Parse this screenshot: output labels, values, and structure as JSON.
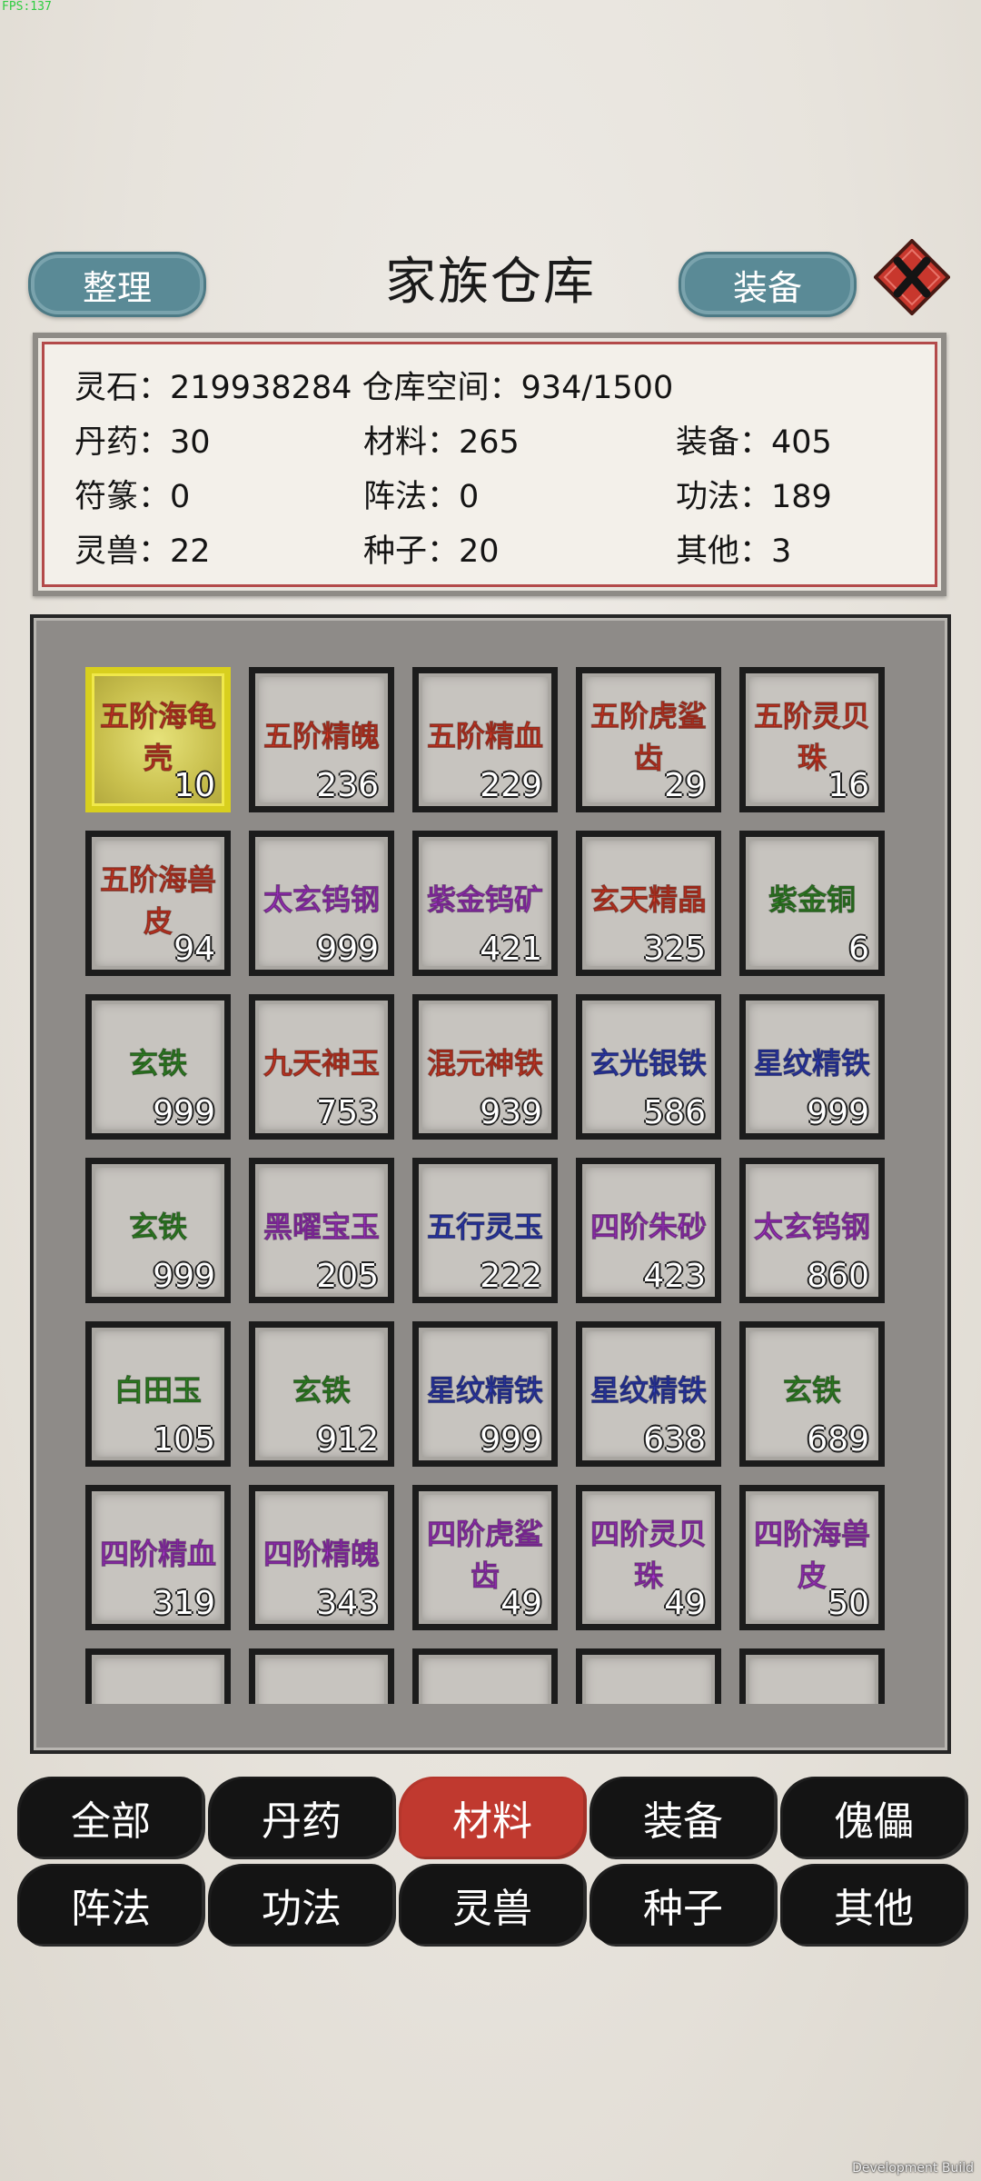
{
  "debug": {
    "fps": "FPS:137",
    "build": "Development Build"
  },
  "header": {
    "left_button": "整理",
    "title": "家族仓库",
    "right_button": "装备",
    "close_icon": "close-icon"
  },
  "stats": {
    "line1": "灵石：219938284 仓库空间：934/1500",
    "cells": [
      [
        "丹药：30",
        "材料：265",
        "装备：405"
      ],
      [
        "符篆：0",
        "阵法：0",
        "功法：189"
      ],
      [
        "灵兽：22",
        "种子：20",
        "其他：3"
      ]
    ]
  },
  "colors": {
    "red": "#e8402a",
    "purple": "#b23ad8",
    "blue": "#3443c8",
    "green": "#3a9a2c",
    "active_tab": "#c0392f"
  },
  "items": [
    {
      "name": "五阶海龟壳",
      "count": "10",
      "quality": "red",
      "selected": true
    },
    {
      "name": "五阶精魄",
      "count": "236",
      "quality": "red"
    },
    {
      "name": "五阶精血",
      "count": "229",
      "quality": "red"
    },
    {
      "name": "五阶虎鲨齿",
      "count": "29",
      "quality": "red"
    },
    {
      "name": "五阶灵贝珠",
      "count": "16",
      "quality": "red"
    },
    {
      "name": "五阶海兽皮",
      "count": "94",
      "quality": "red"
    },
    {
      "name": "太玄钨钢",
      "count": "999",
      "quality": "purple"
    },
    {
      "name": "紫金钨矿",
      "count": "421",
      "quality": "purple"
    },
    {
      "name": "玄天精晶",
      "count": "325",
      "quality": "red"
    },
    {
      "name": "紫金铜",
      "count": "6",
      "quality": "green"
    },
    {
      "name": "玄铁",
      "count": "999",
      "quality": "green"
    },
    {
      "name": "九天神玉",
      "count": "753",
      "quality": "red"
    },
    {
      "name": "混元神铁",
      "count": "939",
      "quality": "red"
    },
    {
      "name": "玄光银铁",
      "count": "586",
      "quality": "blue"
    },
    {
      "name": "星纹精铁",
      "count": "999",
      "quality": "blue"
    },
    {
      "name": "玄铁",
      "count": "999",
      "quality": "green"
    },
    {
      "name": "黑曜宝玉",
      "count": "205",
      "quality": "purple"
    },
    {
      "name": "五行灵玉",
      "count": "222",
      "quality": "blue"
    },
    {
      "name": "四阶朱砂",
      "count": "423",
      "quality": "purple"
    },
    {
      "name": "太玄钨钢",
      "count": "860",
      "quality": "purple"
    },
    {
      "name": "白田玉",
      "count": "105",
      "quality": "green"
    },
    {
      "name": "玄铁",
      "count": "912",
      "quality": "green"
    },
    {
      "name": "星纹精铁",
      "count": "999",
      "quality": "blue"
    },
    {
      "name": "星纹精铁",
      "count": "638",
      "quality": "blue"
    },
    {
      "name": "玄铁",
      "count": "689",
      "quality": "green"
    },
    {
      "name": "四阶精血",
      "count": "319",
      "quality": "purple"
    },
    {
      "name": "四阶精魄",
      "count": "343",
      "quality": "purple"
    },
    {
      "name": "四阶虎鲨齿",
      "count": "49",
      "quality": "purple"
    },
    {
      "name": "四阶灵贝珠",
      "count": "49",
      "quality": "purple"
    },
    {
      "name": "四阶海兽皮",
      "count": "50",
      "quality": "purple"
    },
    {
      "name": "",
      "count": "",
      "quality": "green"
    },
    {
      "name": "",
      "count": "",
      "quality": "green"
    },
    {
      "name": "",
      "count": "",
      "quality": "green"
    },
    {
      "name": "",
      "count": "",
      "quality": "green"
    },
    {
      "name": "",
      "count": "",
      "quality": "green"
    }
  ],
  "tabs": [
    {
      "label": "全部",
      "active": false
    },
    {
      "label": "丹药",
      "active": false
    },
    {
      "label": "材料",
      "active": true
    },
    {
      "label": "装备",
      "active": false
    },
    {
      "label": "傀儡",
      "active": false
    },
    {
      "label": "阵法",
      "active": false
    },
    {
      "label": "功法",
      "active": false
    },
    {
      "label": "灵兽",
      "active": false
    },
    {
      "label": "种子",
      "active": false
    },
    {
      "label": "其他",
      "active": false
    }
  ]
}
